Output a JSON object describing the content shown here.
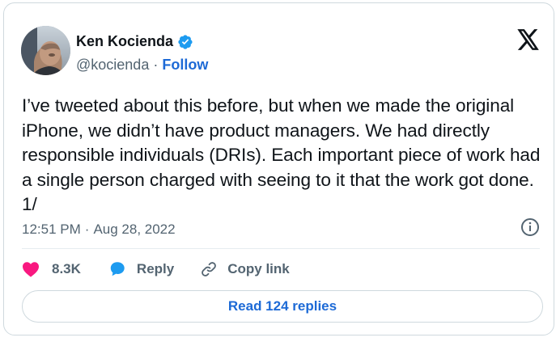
{
  "author": {
    "display_name": "Ken Kocienda",
    "handle": "@kocienda",
    "separator": "·",
    "follow_label": "Follow"
  },
  "tweet": {
    "text": "I’ve tweeted about this before, but when we made the original iPhone, we didn’t have product managers. We had directly responsible individuals (DRIs). Each important piece of work had a single person charged with seeing to it that the work got done. 1/",
    "time": "12:51 PM",
    "separator": "·",
    "date": "Aug 28, 2022"
  },
  "actions": {
    "likes_count": "8.3K",
    "reply_label": "Reply",
    "copy_link_label": "Copy link",
    "read_replies_label": "Read 124 replies"
  },
  "icons": {
    "verified": "verified-badge-icon",
    "x_logo": "x-logo-icon",
    "info": "info-icon",
    "heart": "heart-icon",
    "reply": "speech-bubble-icon",
    "link": "link-icon"
  },
  "colors": {
    "accent": "#1d9bf0",
    "link": "#1d6ad6",
    "heart": "#f91880",
    "text": "#0f1419",
    "muted": "#536471"
  }
}
